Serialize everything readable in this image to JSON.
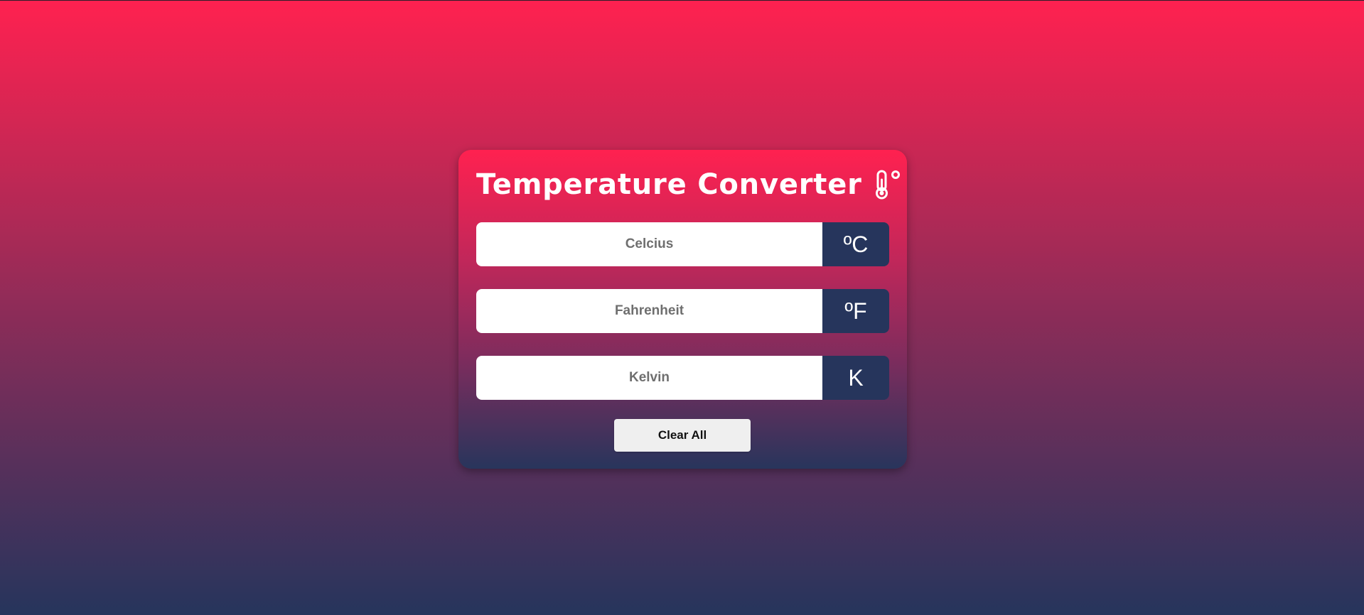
{
  "app": {
    "title": "Temperature Converter",
    "title_icon": "thermometer-degree-icon"
  },
  "fields": [
    {
      "placeholder": "Celcius",
      "value": "",
      "unit": "ºC"
    },
    {
      "placeholder": "Fahrenheit",
      "value": "",
      "unit": "ºF"
    },
    {
      "placeholder": "Kelvin",
      "value": "",
      "unit": "K"
    }
  ],
  "actions": {
    "clear_label": "Clear All"
  },
  "colors": {
    "gradient_top": "#ff2150",
    "gradient_bottom": "#26355c",
    "unit_box": "#26355c",
    "input_bg": "#ffffff",
    "button_bg": "#efefef"
  }
}
